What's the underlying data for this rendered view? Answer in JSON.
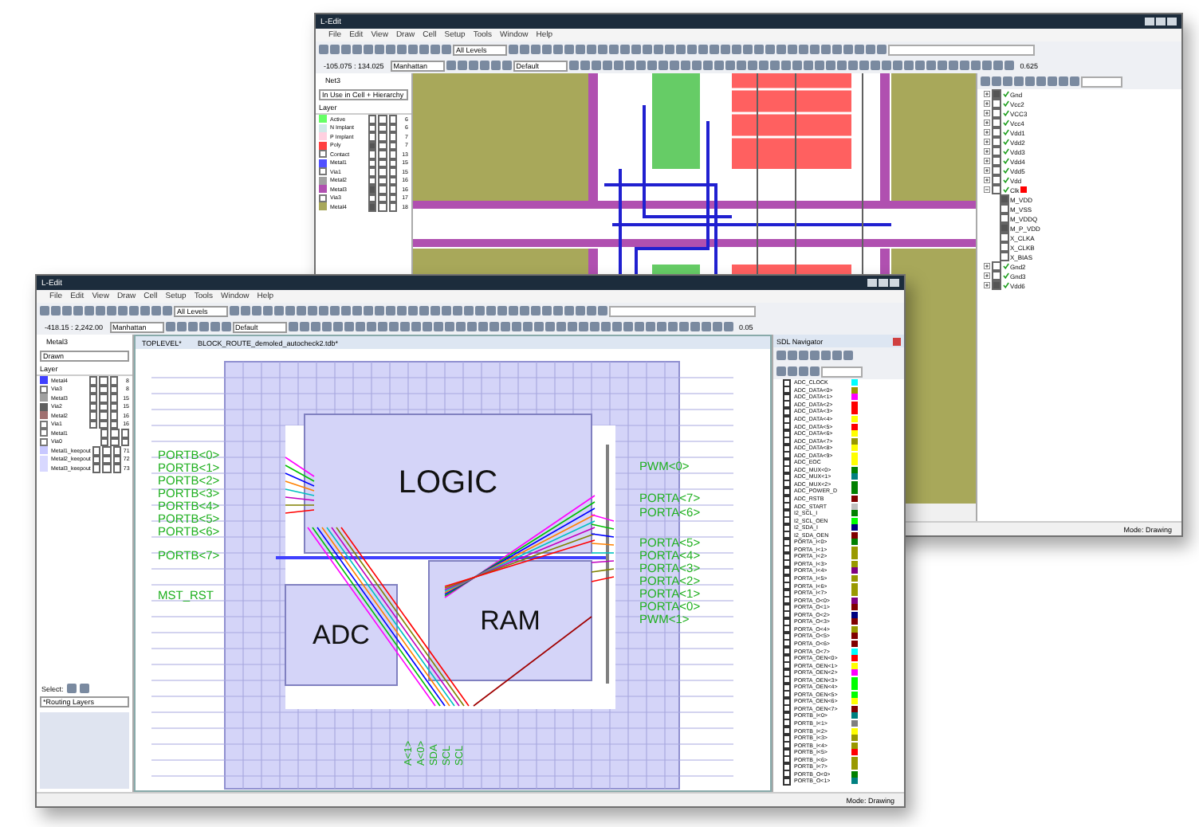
{
  "back_window": {
    "title": "L-Edit",
    "menu": [
      "File",
      "Edit",
      "View",
      "Draw",
      "Cell",
      "Setup",
      "Tools",
      "Window",
      "Help"
    ],
    "coords": "-105.075 : 134.025",
    "orientation": "Manhattan",
    "levels": "All Levels",
    "style": "Default",
    "zoom": "0.625",
    "cell": "Net3",
    "cell_filter": "In Use in Cell + Hierarchy",
    "layer_header": "Layer",
    "layers": [
      {
        "name": "Active",
        "color": "#66ff66",
        "num": "6",
        "checks": [
          false,
          false,
          false
        ]
      },
      {
        "name": "N Implant",
        "color": "#d0e8e8",
        "num": "6",
        "checks": [
          false,
          false,
          false
        ]
      },
      {
        "name": "P Implant",
        "color": "#ffd0e0",
        "num": "7",
        "checks": [
          false,
          false,
          false
        ]
      },
      {
        "name": "Poly",
        "color": "#ff4040",
        "num": "7",
        "checks": [
          true,
          false,
          false
        ]
      },
      {
        "name": "Contact",
        "num": "13",
        "checks": [
          false,
          false,
          false
        ]
      },
      {
        "name": "Metal1",
        "color": "#5050ff",
        "num": "15",
        "checks": [
          false,
          false,
          false
        ]
      },
      {
        "name": "Via1",
        "num": "15",
        "checks": [
          false,
          false,
          false
        ]
      },
      {
        "name": "Metal2",
        "color": "#a0a0a0",
        "num": "16",
        "checks": [
          false,
          false,
          false
        ]
      },
      {
        "name": "Metal3",
        "color": "#b050b0",
        "num": "16",
        "checks": [
          true,
          false,
          false
        ]
      },
      {
        "name": "Via3",
        "num": "17",
        "checks": [
          false,
          false,
          false
        ]
      },
      {
        "name": "Metal4",
        "color": "#a8a85a",
        "num": "18",
        "checks": [
          true,
          false,
          false
        ]
      }
    ],
    "tree": [
      {
        "label": "Gnd",
        "expanded": false,
        "checked": true
      },
      {
        "label": "Vcc2",
        "expanded": false,
        "checked": false
      },
      {
        "label": "VCC3",
        "expanded": false,
        "checked": false
      },
      {
        "label": "Vcc4",
        "expanded": false,
        "checked": false
      },
      {
        "label": "Vdd1",
        "expanded": false,
        "checked": false
      },
      {
        "label": "Vdd2",
        "expanded": false,
        "checked": false
      },
      {
        "label": "Vdd3",
        "expanded": false,
        "checked": false
      },
      {
        "label": "Vdd4",
        "expanded": false,
        "checked": false
      },
      {
        "label": "Vdd5",
        "expanded": false,
        "checked": false
      },
      {
        "label": "Vdd",
        "expanded": false,
        "checked": false
      },
      {
        "label": "Clk",
        "expanded": true,
        "checked": false,
        "color": "#ff0000",
        "children": [
          {
            "label": "M_VDD",
            "checked": true
          },
          {
            "label": "M_VSS",
            "checked": false
          },
          {
            "label": "M_VDDQ",
            "checked": false
          },
          {
            "label": "M_P_VDD",
            "checked": true
          },
          {
            "label": "X_CLKA",
            "checked": false
          },
          {
            "label": "X_CLKB",
            "checked": false
          },
          {
            "label": "X_BIAS",
            "checked": false
          }
        ]
      },
      {
        "label": "Gnd2",
        "expanded": false,
        "checked": false
      },
      {
        "label": "Gnd3",
        "expanded": false,
        "checked": false
      },
      {
        "label": "Vdd6",
        "expanded": false,
        "checked": true
      }
    ],
    "status": "Mode: Drawing"
  },
  "front_window": {
    "title": "L-Edit",
    "menu": [
      "File",
      "Edit",
      "View",
      "Draw",
      "Cell",
      "Setup",
      "Tools",
      "Window",
      "Help"
    ],
    "coords": "-418.15 : 2,242.00",
    "orientation": "Manhattan",
    "levels": "All Levels",
    "style": "Default",
    "zoom": "0.05",
    "cell": "Metal3",
    "cell_filter": "Drawn",
    "layer_header": "Layer",
    "layers": [
      {
        "name": "Metal4",
        "color": "#4040ff",
        "num": "8",
        "checks": [
          false,
          false,
          false
        ]
      },
      {
        "name": "Via3",
        "num": "8",
        "checks": [
          false,
          false,
          false
        ]
      },
      {
        "name": "Metal3",
        "color": "#a0a0a0",
        "num": "15",
        "checks": [
          false,
          false,
          false
        ]
      },
      {
        "name": "Via2",
        "color": "#606060",
        "num": "15",
        "checks": [
          false,
          false,
          false
        ]
      },
      {
        "name": "Metal2",
        "color": "#a07070",
        "num": "16",
        "checks": [
          false,
          false,
          false
        ]
      },
      {
        "name": "Via1",
        "num": "16",
        "checks": [
          false,
          false,
          false
        ]
      },
      {
        "name": "Metal1",
        "checks": [
          false,
          false,
          false
        ]
      },
      {
        "name": "Via0",
        "checks": [
          false,
          false,
          false
        ]
      },
      {
        "name": "Metal1_keepout",
        "color": "#c8c8ff",
        "num": "71",
        "checks": [
          false,
          false,
          false
        ]
      },
      {
        "name": "Metal2_keepout",
        "color": "#d8d8ff",
        "num": "72",
        "checks": [
          false,
          false,
          false
        ]
      },
      {
        "name": "Metal3_keepout",
        "color": "#d8d8ff",
        "num": "73",
        "checks": [
          false,
          false,
          false
        ]
      }
    ],
    "select_label": "Select:",
    "select_value": "*Routing Layers",
    "doc_title": "TOPLEVEL*",
    "doc_path": "BLOCK_ROUTE_demoled_autocheck2.tdb*",
    "blocks": [
      "LOGIC",
      "ADC",
      "RAM"
    ],
    "left_pins": [
      "PORTB<0>",
      "PORTB<1>",
      "PORTB<2>",
      "PORTB<3>",
      "PORTB<4>",
      "PORTB<5>",
      "PORTB<6>",
      "PORTB<7>",
      "MST_RST"
    ],
    "right_pins": [
      "PWM<0>",
      "PORTA<7>",
      "PORTA<6>",
      "PORTA<5>",
      "PORTA<4>",
      "PORTA<3>",
      "PORTA<2>",
      "PORTA<1>",
      "PORTA<0>",
      "PWM<1>"
    ],
    "bottom_pins": [
      "A<1>",
      "A<0>",
      "SDA",
      "SCL",
      "SCL"
    ],
    "navigator_title": "SDL Navigator",
    "nets": [
      {
        "name": "ADC_CLOCK",
        "color": "#00ffff"
      },
      {
        "name": "ADC_DATA<0>",
        "color": "#999900"
      },
      {
        "name": "ADC_DATA<1>",
        "color": "#ff00ff"
      },
      {
        "name": "ADC_DATA<2>",
        "color": "#ff0000"
      },
      {
        "name": "ADC_DATA<3>",
        "color": "#ff0000"
      },
      {
        "name": "ADC_DATA<4>",
        "color": "#ffff00"
      },
      {
        "name": "ADC_DATA<5>",
        "color": "#ff0000"
      },
      {
        "name": "ADC_DATA<6>",
        "color": "#ffff00"
      },
      {
        "name": "ADC_DATA<7>",
        "color": "#999900"
      },
      {
        "name": "ADC_DATA<8>",
        "color": "#ffff00"
      },
      {
        "name": "ADC_DATA<9>",
        "color": "#ffff00"
      },
      {
        "name": "ADC_EOC",
        "color": "#ffff00"
      },
      {
        "name": "ADC_MUX<0>",
        "color": "#008000"
      },
      {
        "name": "ADC_MUX<1>",
        "color": "#008080"
      },
      {
        "name": "ADC_MUX<2>",
        "color": "#008000"
      },
      {
        "name": "ADC_POWER_D",
        "color": "#008000"
      },
      {
        "name": "ADC_RSTB",
        "color": "#800000"
      },
      {
        "name": "ADC_START",
        "color": "#c0c0c0"
      },
      {
        "name": "I2_SCL_I",
        "color": "#008000"
      },
      {
        "name": "I2_SCL_OEN",
        "color": "#00ff00"
      },
      {
        "name": "I2_SDA_I",
        "color": "#000080"
      },
      {
        "name": "I2_SDA_OEN",
        "color": "#800000"
      },
      {
        "name": "PORTA_I<0>",
        "color": "#008000"
      },
      {
        "name": "PORTA_I<1>",
        "color": "#999900"
      },
      {
        "name": "PORTA_I<2>",
        "color": "#999900"
      },
      {
        "name": "PORTA_I<3>",
        "color": "#999900"
      },
      {
        "name": "PORTA_I<4>",
        "color": "#800080"
      },
      {
        "name": "PORTA_I<5>",
        "color": "#999900"
      },
      {
        "name": "PORTA_I<6>",
        "color": "#999900"
      },
      {
        "name": "PORTA_I<7>",
        "color": "#999900"
      },
      {
        "name": "PORTA_O<0>",
        "color": "#800080"
      },
      {
        "name": "PORTA_O<1>",
        "color": "#800000"
      },
      {
        "name": "PORTA_O<2>",
        "color": "#000080"
      },
      {
        "name": "PORTA_O<3>",
        "color": "#800000"
      },
      {
        "name": "PORTA_O<4>",
        "color": "#999900"
      },
      {
        "name": "PORTA_O<5>",
        "color": "#800000"
      },
      {
        "name": "PORTA_O<6>",
        "color": "#800000"
      },
      {
        "name": "PORTA_O<7>",
        "color": "#00ffff"
      },
      {
        "name": "PORTA_OEN<0>",
        "color": "#ff0000"
      },
      {
        "name": "PORTA_OEN<1>",
        "color": "#ffff00"
      },
      {
        "name": "PORTA_OEN<2>",
        "color": "#ff00ff"
      },
      {
        "name": "PORTA_OEN<3>",
        "color": "#00ff00"
      },
      {
        "name": "PORTA_OEN<4>",
        "color": "#00ff00"
      },
      {
        "name": "PORTA_OEN<5>",
        "color": "#00ff00"
      },
      {
        "name": "PORTA_OEN<6>",
        "color": "#ffff00"
      },
      {
        "name": "PORTA_OEN<7>",
        "color": "#800000"
      },
      {
        "name": "PORTB_I<0>",
        "color": "#008080"
      },
      {
        "name": "PORTB_I<1>",
        "color": "#808080"
      },
      {
        "name": "PORTB_I<2>",
        "color": "#ffff00"
      },
      {
        "name": "PORTB_I<3>",
        "color": "#999900"
      },
      {
        "name": "PORTB_I<4>",
        "color": "#999900"
      },
      {
        "name": "PORTB_I<5>",
        "color": "#ff0000"
      },
      {
        "name": "PORTB_I<6>",
        "color": "#999900"
      },
      {
        "name": "PORTB_I<7>",
        "color": "#999900"
      },
      {
        "name": "PORTB_O<0>",
        "color": "#008000"
      },
      {
        "name": "PORTB_O<1>",
        "color": "#008080"
      }
    ],
    "status": "Mode: Drawing"
  }
}
